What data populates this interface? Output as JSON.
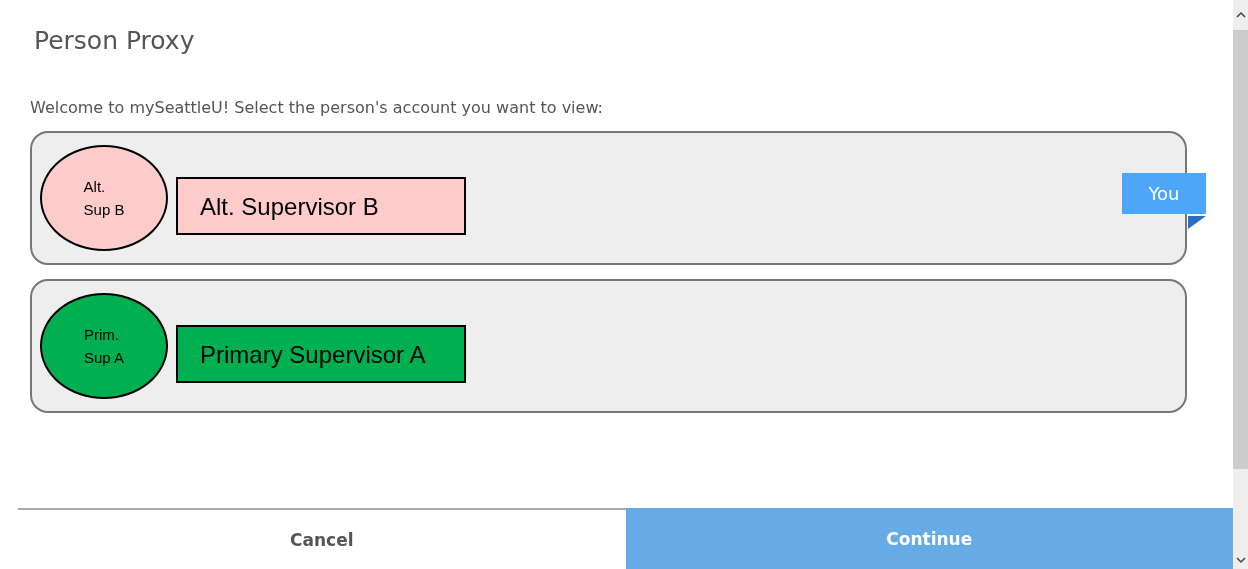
{
  "dialog": {
    "title": "Person Proxy",
    "prompt": "Welcome to mySeattleU! Select the person's account you want to view:"
  },
  "people": [
    {
      "avatar_text": "Alt.\nSup B",
      "name": "Alt. Supervisor B",
      "color": "#ffcccc",
      "badge": "You"
    },
    {
      "avatar_text": "Prim.\nSup A",
      "name": "Primary Supervisor A",
      "color": "#00b050"
    }
  ],
  "buttons": [
    {
      "label": "Cancel",
      "kind": "secondary"
    },
    {
      "label": "Continue",
      "kind": "primary"
    }
  ]
}
